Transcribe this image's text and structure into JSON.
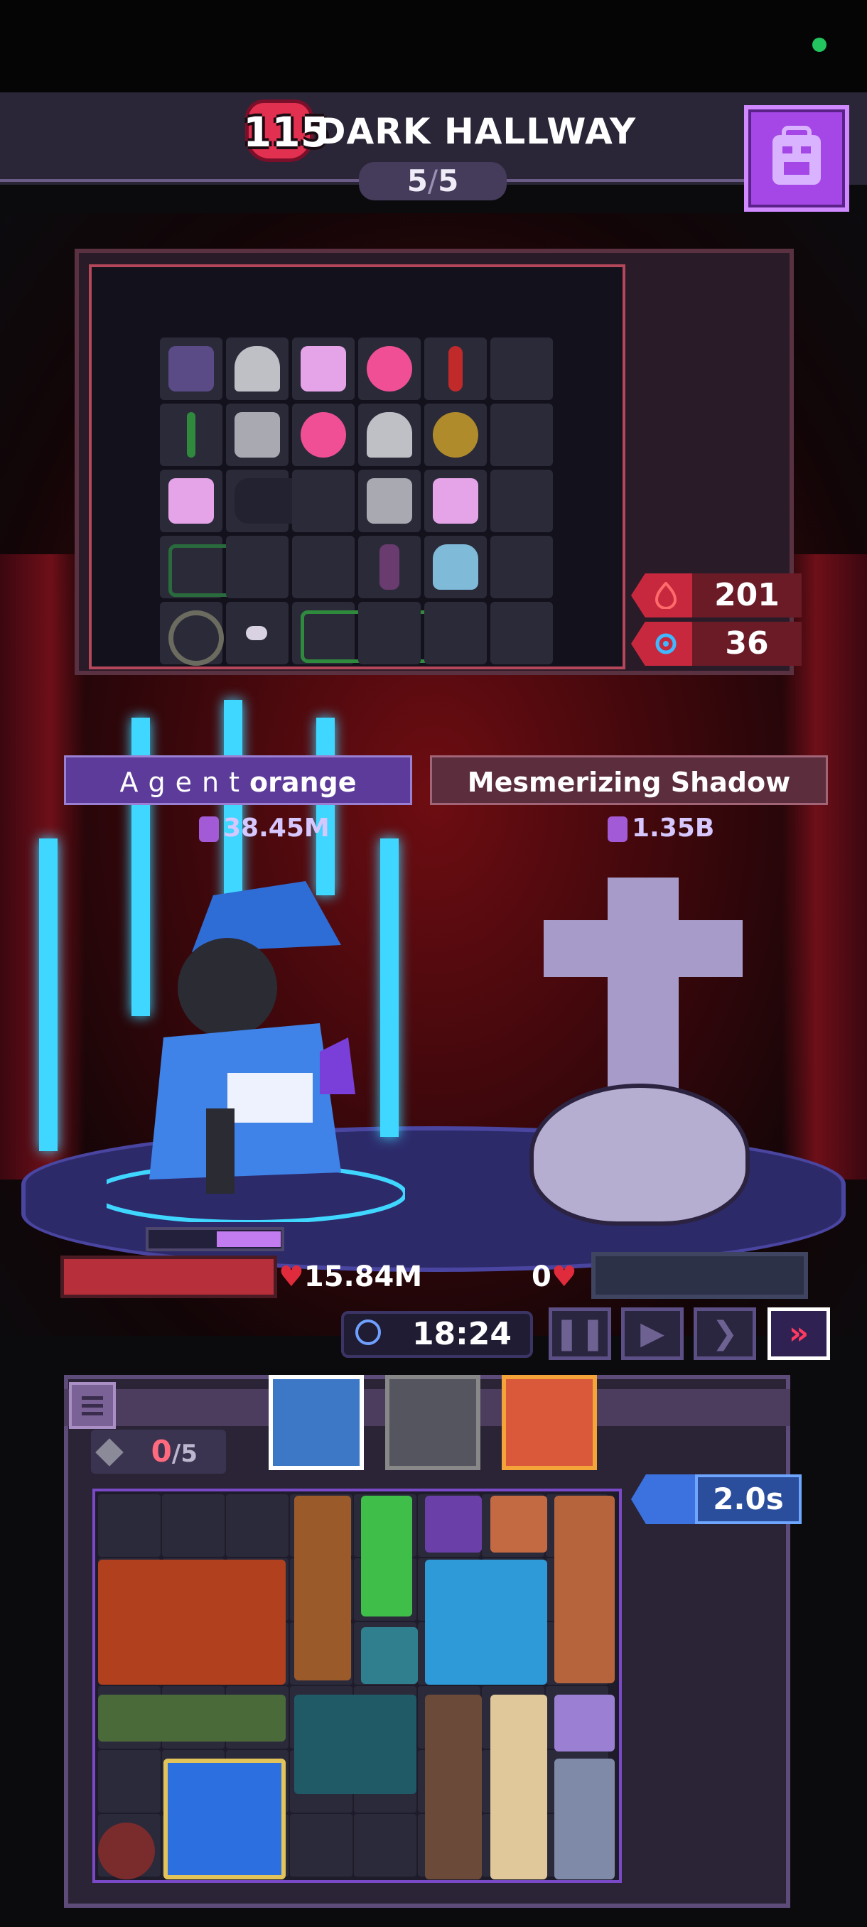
{
  "header": {
    "level": "115",
    "stage_title": "DARK HALLWAY",
    "wave_current": "5",
    "wave_separator": "/",
    "wave_total": "5"
  },
  "loot_stats": {
    "attack_value": "201",
    "defense_value": "36"
  },
  "battle": {
    "player_name_spaced": "Agent",
    "player_name_bold": "orange",
    "player_power": "38.45M",
    "enemy_name": "Mesmerizing Shadow",
    "enemy_power": "1.35B",
    "player_hp": "15.84M",
    "enemy_hp": "0",
    "player_mana_fraction": 0.5,
    "enemy_hp_fraction": 0.0
  },
  "controls": {
    "timer": "18:24",
    "pause_icon": "pause-icon",
    "play_icon": "play-icon",
    "fast_icon": "fast-forward-icon",
    "fastest_icon": "double-chevron-icon",
    "active_speed": "fastest"
  },
  "inventory": {
    "slots_used": "0",
    "slots_sep": "/",
    "slots_max": "5",
    "cooldown": "2.0s"
  },
  "colors": {
    "hp": "#b82f3c",
    "mana": "#c37cf0",
    "accent_purple": "#a547e6",
    "accent_red": "#c8283e",
    "accent_blue": "#3b72e0"
  }
}
